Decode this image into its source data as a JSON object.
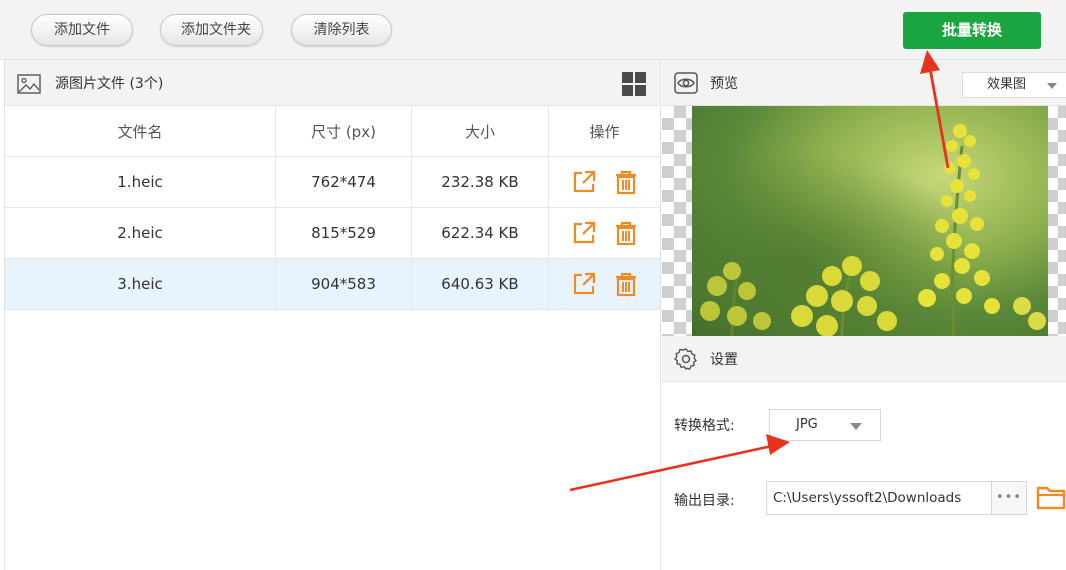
{
  "toolbar": {
    "add_file": "添加文件",
    "add_folder": "添加文件夹",
    "clear_list": "清除列表",
    "batch_convert": "批量转换"
  },
  "source_panel": {
    "title": "源图片文件 (3个)",
    "columns": [
      "文件名",
      "尺寸 (px)",
      "大小",
      "操作"
    ],
    "files": [
      {
        "name": "1.heic",
        "size_px": "762*474",
        "filesize": "232.38 KB"
      },
      {
        "name": "2.heic",
        "size_px": "815*529",
        "filesize": "622.34 KB"
      },
      {
        "name": "3.heic",
        "size_px": "904*583",
        "filesize": "640.63 KB"
      }
    ],
    "selected_row": 3
  },
  "preview": {
    "title": "预览",
    "mode": "效果图"
  },
  "settings": {
    "title": "设置",
    "format_label": "转换格式:",
    "format_value": "JPG",
    "output_label": "输出目录:",
    "output_path": "C:\\Users\\yssoft2\\Downloads",
    "browse_dots": "•••"
  },
  "colors": {
    "primary_green": "#1aa541",
    "icon_orange": "#f08a24",
    "arrow_red": "#e8321e",
    "selected_row": "#e8f4fd"
  },
  "icons": [
    "image-icon",
    "grid-view-icon",
    "open-external-icon",
    "trash-icon",
    "eye-icon",
    "gear-icon",
    "folder-icon",
    "dropdown-arrow-icon"
  ]
}
